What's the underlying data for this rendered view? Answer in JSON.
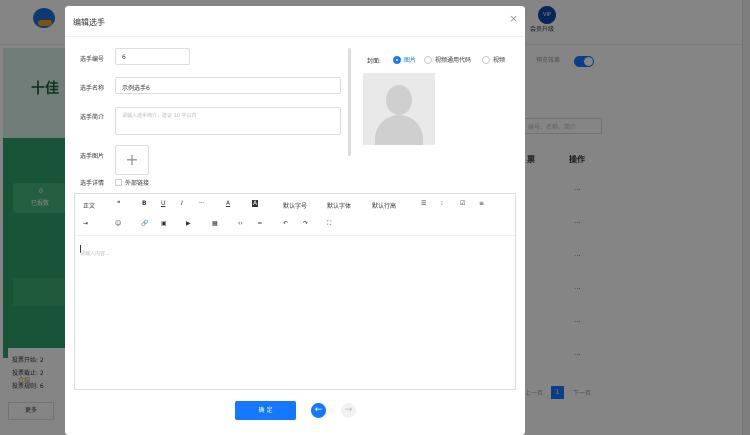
{
  "background": {
    "member_label": "会员升级",
    "vip_badge": "VIP",
    "preview": {
      "title": "十佳",
      "count": "0",
      "count_label": "已报数",
      "info1": "投票开始: 2",
      "info2": "投票截止: 2",
      "info3": "投票规则: 6",
      "intro_tab": "介绍",
      "more": "更多"
    },
    "preview_effect_label": "预览效果",
    "search_placeholder": "编号、名称、简介",
    "columns": {
      "votes": "票",
      "actions": "操作"
    },
    "row_action": "···",
    "pager": {
      "prev": "上一页",
      "current": "1",
      "next": "下一页"
    }
  },
  "modal": {
    "title": "编辑选手",
    "close": "×",
    "fields": {
      "number_label": "选手编号",
      "number_value": "6",
      "name_label": "选手名称",
      "name_value": "示例选手6",
      "intro_label": "选手简介",
      "intro_placeholder": "请输入选手简介，建议 10 字以内",
      "image_label": "选手图片",
      "upload_plus": "+",
      "detail_label": "选手详情",
      "external_link_label": "外部链接"
    },
    "cover": {
      "label": "封面:",
      "options": [
        "图片",
        "视频通用代码",
        "视频"
      ],
      "selected": "图片"
    },
    "toolbar": {
      "text_style": "正文",
      "quote": "❝",
      "bold": "B",
      "underline": "U",
      "italic": "I",
      "more": "···",
      "font_color": "A",
      "bg_color": "A",
      "font_size": "默认字号",
      "font_family": "默认字体",
      "line_height": "默认行高",
      "bullet_list": "☰",
      "numbered_list": "⁝",
      "todo": "☑",
      "align": "≡",
      "indent": "⇥",
      "emoji": "☺",
      "link": "🔗",
      "image": "▣",
      "video": "▶",
      "table": "▦",
      "code": "‹›",
      "divider": "═",
      "undo": "↶",
      "redo": "↷",
      "fullscreen": "⛶"
    },
    "editor_placeholder": "请输入内容...",
    "confirm_label": "确 定",
    "prev_label": "←",
    "next_label": "→"
  }
}
